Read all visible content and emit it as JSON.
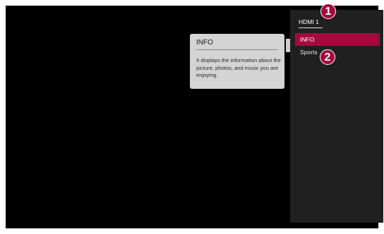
{
  "input_menu": {
    "title": "HDMI 1",
    "items": [
      {
        "label": "INFO",
        "selected": true
      },
      {
        "label": "Sports",
        "selected": false
      }
    ]
  },
  "tooltip": {
    "title": "INFO",
    "body": "It displays the information about the picture, photos, and music you are enjoying."
  },
  "callouts": {
    "one": "1",
    "two": "2"
  },
  "colors": {
    "accent": "#a50a3f",
    "panel": "#202020",
    "screen": "#000000",
    "tooltip_bg": "#d4d4d4"
  }
}
